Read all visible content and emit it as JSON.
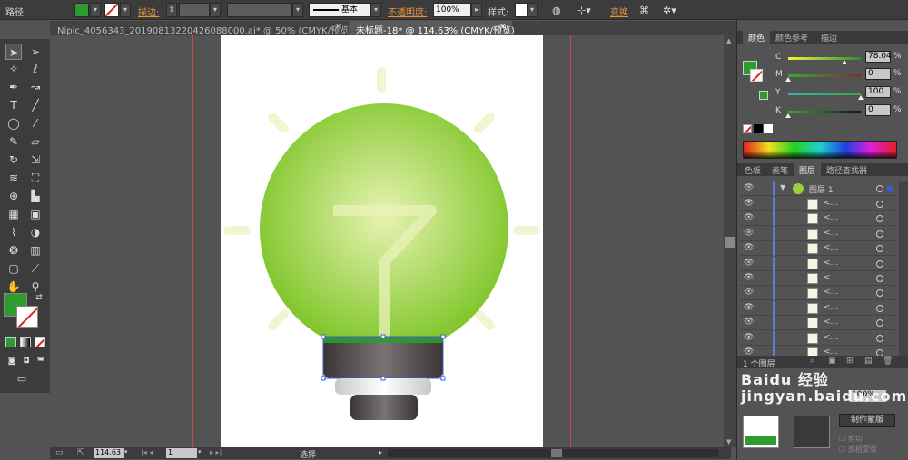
{
  "control_bar": {
    "path_label": "路径",
    "stroke_label": "描边:",
    "stroke_style": "基本",
    "opacity_label": "不透明度:",
    "opacity_value": "100%",
    "style_label": "样式:",
    "transform_label": "变换",
    "fill_color": "#2e9b2e"
  },
  "tabs": [
    {
      "label": "Nipic_4056343_20190813220426088000.ai* @ 50% (CMYK/预览)"
    },
    {
      "label": "未标题-18* @ 114.63% (CMYK/预览)"
    }
  ],
  "toolbar": {
    "fill_color": "#2e9b2e",
    "icons": [
      "selection-icon",
      "direct-selection-icon",
      "magic-wand-icon",
      "lasso-icon",
      "pen-icon",
      "curvature-icon",
      "type-icon",
      "line-icon",
      "ellipse-icon",
      "paintbrush-icon",
      "pencil-icon",
      "eraser-icon",
      "rotate-icon",
      "scale-icon",
      "warp-icon",
      "free-transform-icon",
      "shape-builder-icon",
      "perspective-icon",
      "mesh-icon",
      "gradient-icon",
      "eyedropper-icon",
      "blend-icon",
      "symbol-sprayer-icon",
      "graph-icon",
      "artboard-icon",
      "slice-icon",
      "hand-icon",
      "zoom-icon"
    ]
  },
  "status_bar": {
    "zoom": "114.63",
    "page": "1",
    "tool_name": "选择"
  },
  "color_panel": {
    "tabs": [
      "颜色",
      "颜色参考",
      "描边"
    ],
    "channels": [
      {
        "name": "C",
        "value": "78.04",
        "gradient": "linear-gradient(90deg,#f5f542,#2b8f2b)",
        "pos": 0.78
      },
      {
        "name": "M",
        "value": "0",
        "gradient": "linear-gradient(90deg,#3aa83a,#7a2e2e)",
        "pos": 0.0
      },
      {
        "name": "Y",
        "value": "100",
        "gradient": "linear-gradient(90deg,#3ab0b0,#3aa83a)",
        "pos": 1.0
      },
      {
        "name": "K",
        "value": "0",
        "gradient": "linear-gradient(90deg,#3aa83a,#0a1a0a)",
        "pos": 0.0
      }
    ],
    "fill_color": "#2e9b2e"
  },
  "layers_panel": {
    "tabs": [
      "色板",
      "画笔",
      "图层",
      "路径查找器"
    ],
    "layer_name": "图层 1",
    "sublayer_label": "<...",
    "rows": 11,
    "footer": "1 个图层"
  },
  "transparency_panel": {
    "opacity": "100%",
    "make_mask_button": "制作蒙版",
    "clip_label": "剪切",
    "invert_mask_label": "反相蒙版"
  },
  "watermark": "Baidu 经验 jingyan.baidu.com",
  "artwork": {
    "bulb_gradient_inner": "#e7f3b2",
    "bulb_gradient_outer": "#7ec528",
    "ray_color": "#f2f5d2",
    "base_dark": "#4d4445",
    "base_light": "#ececec"
  }
}
